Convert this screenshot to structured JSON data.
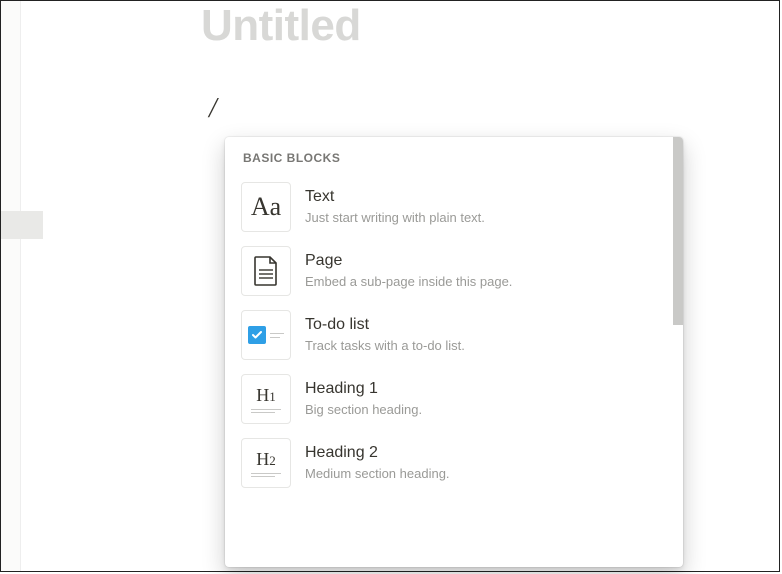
{
  "page": {
    "title_placeholder": "Untitled",
    "slash_trigger": "/"
  },
  "menu": {
    "section_label": "BASIC BLOCKS",
    "items": [
      {
        "icon": "text-aa-icon",
        "title": "Text",
        "desc": "Just start writing with plain text."
      },
      {
        "icon": "page-doc-icon",
        "title": "Page",
        "desc": "Embed a sub-page inside this page."
      },
      {
        "icon": "todo-check-icon",
        "title": "To-do list",
        "desc": "Track tasks with a to-do list."
      },
      {
        "icon": "heading1-icon",
        "title": "Heading 1",
        "desc": "Big section heading."
      },
      {
        "icon": "heading2-icon",
        "title": "Heading 2",
        "desc": "Medium section heading."
      }
    ]
  }
}
